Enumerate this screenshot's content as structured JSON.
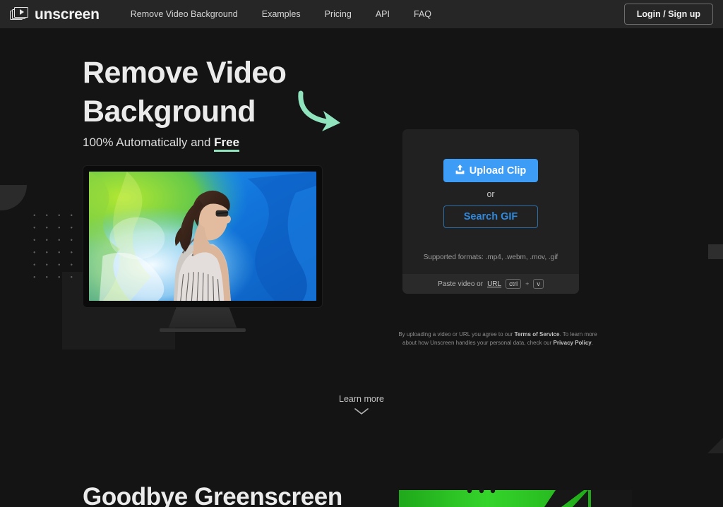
{
  "nav": {
    "logo_text": "unscreen",
    "logo_icon": "video-frames-play-icon",
    "links": [
      {
        "label": "Remove Video Background"
      },
      {
        "label": "Examples"
      },
      {
        "label": "Pricing"
      },
      {
        "label": "API"
      },
      {
        "label": "FAQ"
      }
    ],
    "login_label": "Login / Sign up"
  },
  "hero": {
    "title_line1": "Remove Video",
    "title_line2": "Background",
    "subtitle_prefix": "100% Automatically and ",
    "subtitle_highlight": "Free",
    "arrow_icon": "curved-arrow-down-right-icon",
    "arrow_color": "#8fe3bd",
    "underline_color": "#8fe3bd"
  },
  "upload_card": {
    "upload_label": "Upload Clip",
    "upload_icon": "upload-icon",
    "or_label": "or",
    "search_gif_label": "Search GIF",
    "formats_label": "Supported formats: .mp4, .webm, .mov, .gif",
    "paste_prefix": "Paste video or ",
    "paste_link": "URL",
    "key_ctrl": "ctrl",
    "key_plus": "+",
    "key_v": "v",
    "accent_color": "#3d9cf5",
    "gif_text_color": "#2f8adf"
  },
  "legal": {
    "line1_a": "By uploading a video or URL you agree to our ",
    "line1_b": "Terms of Service",
    "line1_c": ". To learn more about",
    "line2_a": "how Unscreen handles your personal data, check our ",
    "line2_b": "Privacy Policy",
    "line2_c": "."
  },
  "learn_more": {
    "label": "Learn more",
    "icon": "chevron-down-icon"
  },
  "section2": {
    "title": "Goodbye Greenscreen",
    "image_alt": "greenscreen-demo-image",
    "greenscreen_color": "#2dc224"
  },
  "colors": {
    "page_background": "#141414",
    "navbar_background": "#262626",
    "card_background": "#212121",
    "card_footer_background": "#2a2a2a"
  }
}
